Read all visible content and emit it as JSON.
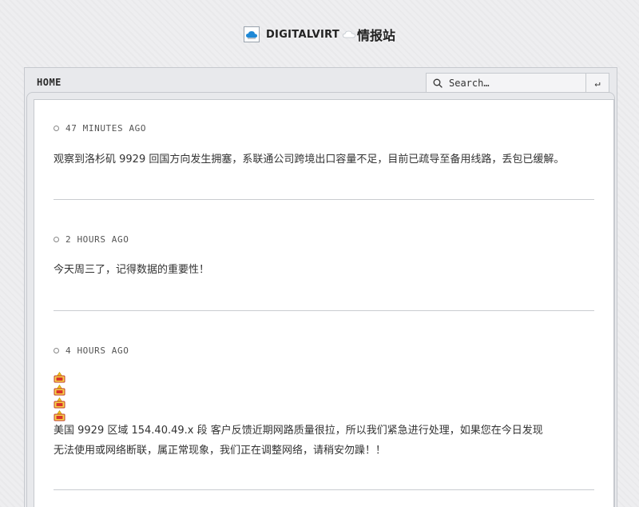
{
  "header": {
    "site_name": "DIGITALVIRT",
    "site_suffix": "情报站"
  },
  "nav": {
    "home_label": "HOME"
  },
  "search": {
    "placeholder": "Search…",
    "submit_glyph": "↵"
  },
  "posts": [
    {
      "time": "47 MINUTES AGO",
      "text": "观察到洛杉矶 9929 回国方向发生拥塞，系联通公司跨境出口容量不足，目前已疏导至备用线路，丢包已缓解。"
    },
    {
      "time": "2 HOURS AGO",
      "text": "今天周三了，记得数据的重要性！"
    },
    {
      "time": "4 HOURS AGO",
      "emoji_icons": [
        "warning-sign-icon",
        "warning-sign-icon",
        "warning-sign-icon",
        "warning-sign-icon"
      ],
      "text_line1": "美国 9929 区域 154.40.49.x 段 客户反馈近期网路质量很拉，所以我们紧急进行处理，如果您在今日发现",
      "text_line2": "无法使用或网络断联，属正常现象，我们正在调整网络，请稍安勿躁！！"
    }
  ]
}
